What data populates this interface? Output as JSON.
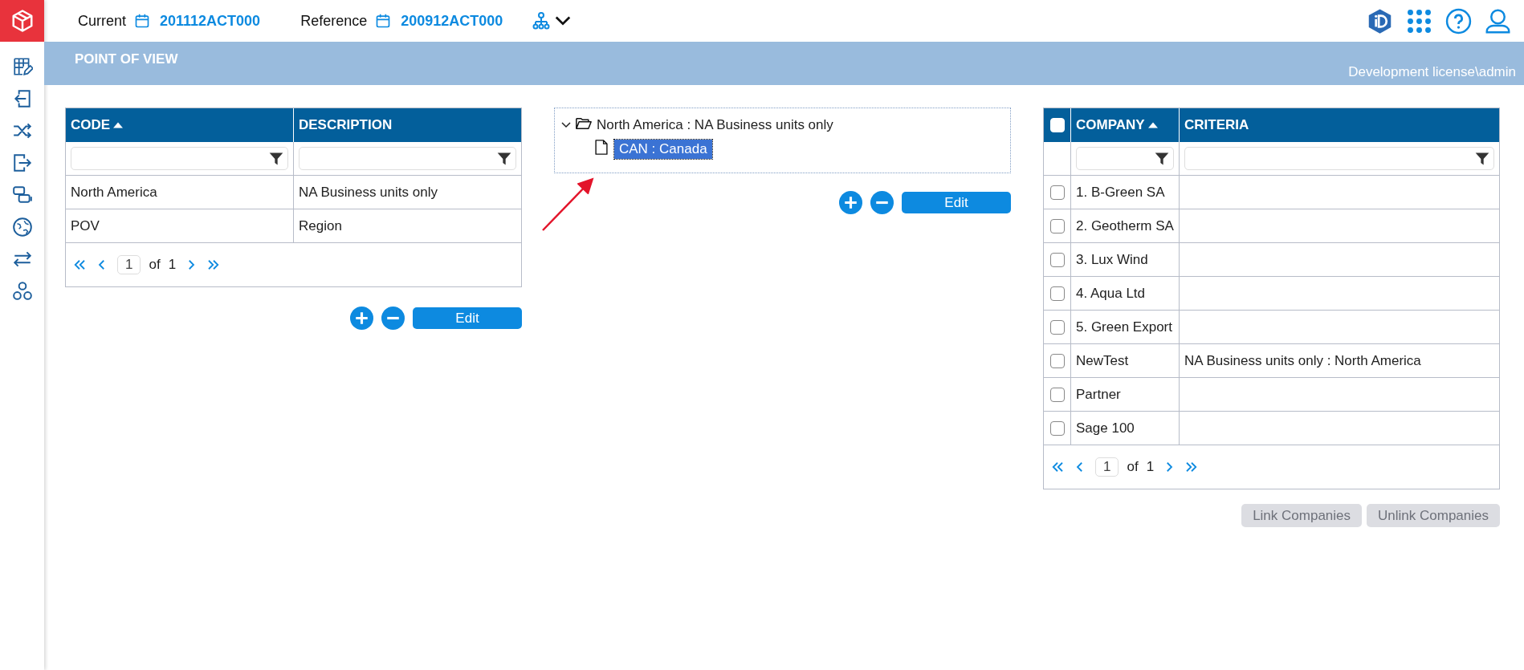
{
  "header": {
    "current_label": "Current",
    "current_value": "201112ACT000",
    "reference_label": "Reference",
    "reference_value": "200912ACT000"
  },
  "band": {
    "title": "POINT OF VIEW",
    "user": "Development license\\admin"
  },
  "code_table": {
    "columns": [
      {
        "label": "CODE",
        "sorted": true
      },
      {
        "label": "DESCRIPTION",
        "sorted": false
      }
    ],
    "rows": [
      {
        "code": "North America",
        "description": "NA Business units only"
      },
      {
        "code": "POV",
        "description": "Region"
      }
    ],
    "pager": {
      "page": "1",
      "of_label": "of",
      "total": "1"
    },
    "edit_label": "Edit"
  },
  "tree": {
    "label": "North America : NA Business units only",
    "expanded": true,
    "children": [
      {
        "label": "CAN : Canada",
        "selected": true
      }
    ],
    "edit_label": "Edit"
  },
  "company_table": {
    "all_checked": false,
    "columns": [
      {
        "label": "COMPANY",
        "sorted": true
      },
      {
        "label": "CRITERIA",
        "sorted": false
      }
    ],
    "rows": [
      {
        "checked": false,
        "company": "1. B-Green SA",
        "criteria": ""
      },
      {
        "checked": false,
        "company": "2. Geotherm SA",
        "criteria": ""
      },
      {
        "checked": false,
        "company": "3. Lux Wind",
        "criteria": ""
      },
      {
        "checked": false,
        "company": "4. Aqua Ltd",
        "criteria": ""
      },
      {
        "checked": false,
        "company": "5. Green Export",
        "criteria": ""
      },
      {
        "checked": false,
        "company": "NewTest",
        "criteria": "NA Business units only : North America"
      },
      {
        "checked": false,
        "company": "Partner",
        "criteria": ""
      },
      {
        "checked": false,
        "company": "Sage 100",
        "criteria": ""
      }
    ],
    "pager": {
      "page": "1",
      "of_label": "of",
      "total": "1"
    },
    "buttons": [
      {
        "label": "Link Companies",
        "disabled": true
      },
      {
        "label": "Unlink Companies",
        "disabled": true
      }
    ]
  }
}
